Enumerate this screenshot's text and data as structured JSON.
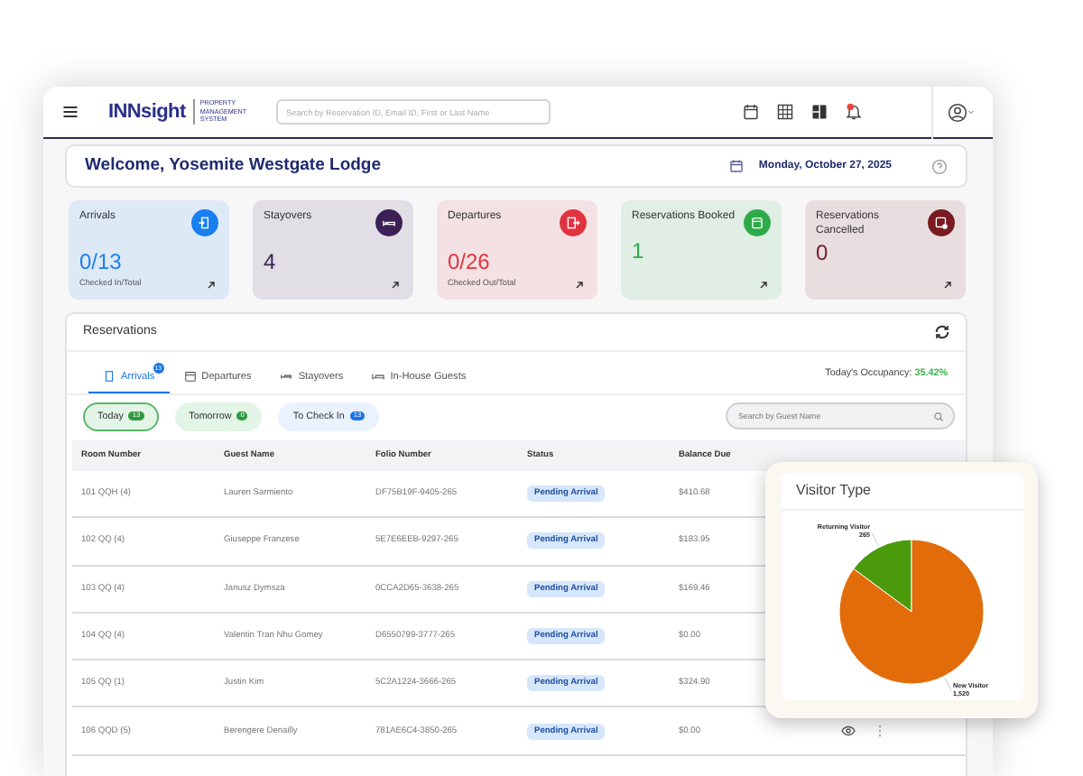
{
  "navbar": {
    "logo_name": "INNsight",
    "logo_tagline": [
      "PROPERTY",
      "MANAGEMENT",
      "SYSTEM"
    ],
    "search": {
      "placeholder": "Search by Reservation ID, Email ID, First or Last Name"
    },
    "has_notification": true
  },
  "welcome": {
    "title": "Welcome, Yosemite Westgate Lodge",
    "date": "Monday, October 27, 2025"
  },
  "stats": [
    {
      "label": "Arrivals",
      "value": "0/13",
      "caption": "Checked In/Total",
      "color": "#1a7ff0"
    },
    {
      "label": "Stayovers",
      "value": "4",
      "color": "#3b1f55"
    },
    {
      "label": "Departures",
      "value": "0/26",
      "caption": "Checked Out/Total",
      "color": "#e03340"
    },
    {
      "label": "Reservations Booked",
      "value": "1",
      "color": "#2eaa4a"
    },
    {
      "label": "Reservations Cancelled",
      "value": "0",
      "color": "#7a1a22"
    }
  ],
  "reservations": {
    "title": "Reservations",
    "tabs": [
      {
        "label": "Arrivals",
        "badge": "13",
        "selected": true
      },
      {
        "label": "Departures",
        "selected": false
      },
      {
        "label": "Stayovers",
        "selected": false
      },
      {
        "label": "In-House Guests",
        "selected": false
      }
    ],
    "occupancy": {
      "label": "Today's Occupancy:",
      "value": "35.42%"
    },
    "filters": [
      {
        "label": "Today",
        "count": "13",
        "kind": "green",
        "selected": true
      },
      {
        "label": "Tomorrow",
        "count": "0",
        "kind": "green",
        "selected": false
      },
      {
        "label": "To Check In",
        "count": "13",
        "kind": "blue",
        "selected": false
      }
    ],
    "search": {
      "placeholder": "Search by Guest Name"
    },
    "table": {
      "columns": [
        "Room Number",
        "Guest Name",
        "Folio Number",
        "Status",
        "Balance Due"
      ],
      "rows": [
        {
          "room": "101 QQH (4)",
          "guest": "Lauren Sarmiento",
          "folio": "DF75B19F-9405-265",
          "status": "Pending Arrival",
          "balance": "$410.68"
        },
        {
          "room": "102 QQ (4)",
          "guest": "Giuseppe Franzese",
          "folio": "5E7E6EEB-9297-265",
          "status": "Pending Arrival",
          "balance": "$183.95"
        },
        {
          "room": "103 QQ (4)",
          "guest": "Janusz Dymsza",
          "folio": "0CCA2D65-3638-265",
          "status": "Pending Arrival",
          "balance": "$169.46"
        },
        {
          "room": "104 QQ (4)",
          "guest": "Valentin Tran Nhu Gomey",
          "folio": "D6550799-3777-265",
          "status": "Pending Arrival",
          "balance": "$0.00"
        },
        {
          "room": "105 QQ (1)",
          "guest": "Justin Kim",
          "folio": "5C2A1224-3666-265",
          "status": "Pending Arrival",
          "balance": "$324.90"
        },
        {
          "room": "106 QQD (5)",
          "guest": "Berengere Denailly",
          "folio": "781AE6C4-3850-265",
          "status": "Pending Arrival",
          "balance": "$0.00",
          "actions_shown": true
        }
      ]
    }
  },
  "visitor_popup": {
    "title": "Visitor Type",
    "chart_data": {
      "type": "pie",
      "categories": [
        "Returning Visitor",
        "New Visitor"
      ],
      "values": [
        265,
        1520
      ],
      "value_labels": [
        "265",
        "1,520"
      ],
      "colors": [
        "#4a9a0c",
        "#e36c0a"
      ],
      "data_labels": true
    }
  }
}
